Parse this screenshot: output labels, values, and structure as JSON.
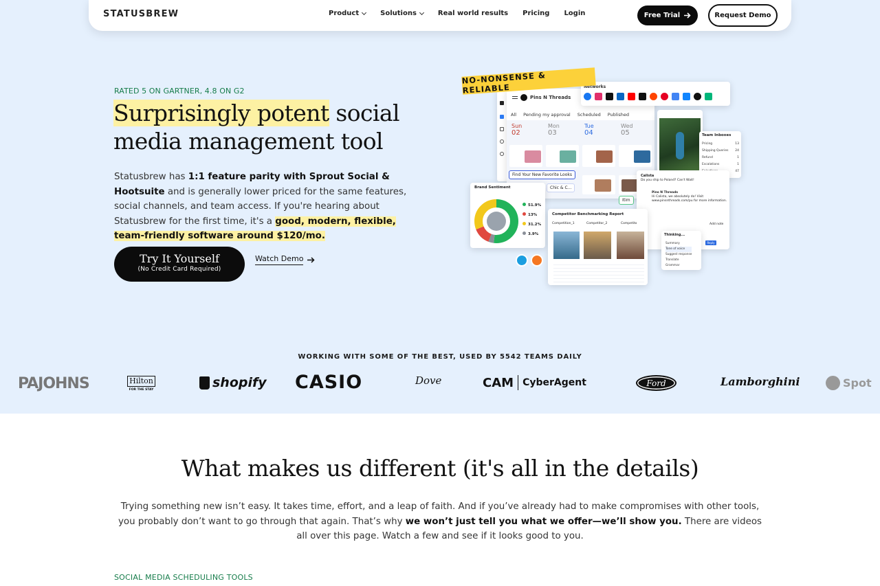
{
  "nav": {
    "logo": "STATUSBREW",
    "links": [
      {
        "label": "Product",
        "dropdown": true
      },
      {
        "label": "Solutions",
        "dropdown": true
      },
      {
        "label": "Real world results",
        "dropdown": false
      },
      {
        "label": "Pricing",
        "dropdown": false
      },
      {
        "label": "Login",
        "dropdown": false
      }
    ],
    "free_trial": "Free Trial",
    "request_demo": "Request Demo"
  },
  "hero": {
    "rated": "RATED 5 ON GARTNER, 4.8 ON G2",
    "title_highlight": "Surprisingly potent",
    "title_rest": " social media management tool",
    "desc_1": "Statusbrew has ",
    "desc_bold": "1:1 feature parity with Sprout Social & Hootsuite",
    "desc_2": " and is generally lower priced for the same features, social channels, and team access. If you're hearing about Statusbrew for the first time, it's a ",
    "desc_highlight": "good, modern, flexible, team-friendly software around $120/mo.",
    "try_title": "Try It Yourself",
    "try_sub": "(No Credit Card Required)",
    "watch_demo": "Watch Demo",
    "badge": "NO-NONSENSE & RELIABLE"
  },
  "mockup": {
    "networks_label": "Networks",
    "account": "Pins N Threads",
    "tabs": [
      "All",
      "Pending my approval",
      "Scheduled",
      "Published"
    ],
    "days": [
      {
        "name": "Sun",
        "num": "02"
      },
      {
        "name": "Mon",
        "num": "03"
      },
      {
        "name": "Tue",
        "num": "04"
      },
      {
        "name": "Wed",
        "num": "05"
      }
    ],
    "chip_looks": "Find Your New Favorite Looks",
    "chip_chic": "Chic & C...",
    "chip_itm": "Itim",
    "brand_sentiment": "Brand Sentiment",
    "sentiment": [
      {
        "pct": "51.9%",
        "color": "#21b35a"
      },
      {
        "pct": "13%",
        "color": "#e0483f"
      },
      {
        "pct": "31.2%",
        "color": "#f2c81b"
      },
      {
        "pct": "3.9%",
        "color": "#8a8f98"
      }
    ],
    "competitor_title": "Competitor Benchmarking Report",
    "competitors": [
      "Competition_1",
      "Competitor_2",
      "Competito"
    ],
    "team_inboxes": "Team Inboxes",
    "inbox_items": [
      {
        "label": "Pricing",
        "count": "13"
      },
      {
        "label": "Shipping Queries",
        "count": "24"
      },
      {
        "label": "Refund",
        "count": "1"
      },
      {
        "label": "Escalations",
        "count": "1"
      },
      {
        "label": "Salesforce",
        "count": "47"
      }
    ],
    "msg_from": "Calista",
    "msg_text": "Do you ship to Poland? Can't Wait!",
    "reply_from": "Pins N Threads",
    "reply_text": "Hi Calista, we absolutely do! Visit www.pinsnthreads.com/pu for more information.",
    "thinking": "Thinking...",
    "ai_options": [
      "Summary",
      "Tone of voice",
      "Suggest response",
      "Translate",
      "Grammar"
    ],
    "add_note": "Add note",
    "reply_btn": "Reply"
  },
  "logos": {
    "heading": "WORKING WITH SOME OF THE BEST, USED BY 5542 TEAMS DAILY",
    "brands": [
      "PAJOHNS",
      "Hilton",
      "FOR THE STAY",
      "shopify",
      "CASIO",
      "Dove",
      "CAM",
      "CyberAgent",
      "Ford",
      "Lamborghini",
      "Spot"
    ]
  },
  "section2": {
    "title": "What makes us different (it's all in the details)",
    "p_1": "Trying something new isn’t easy. It takes time, effort, and a leap of faith. And if you’ve already had to make compromises with other tools, you probably don’t want to go through that again. That’s why ",
    "p_bold": "we won’t just tell you what we offer—we’ll show you.",
    "p_2": " There are videos all over this page. Watch a few and see if it looks good to you.",
    "label": "SOCIAL MEDIA SCHEDULING TOOLS"
  }
}
